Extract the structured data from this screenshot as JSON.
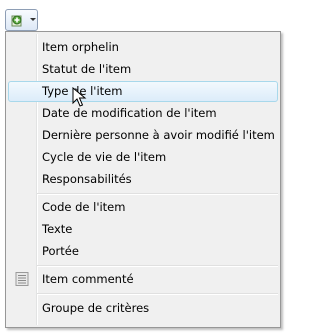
{
  "toolbar": {
    "button_icon": "add-column-icon"
  },
  "menu": {
    "items": [
      {
        "label": "Item orphelin"
      },
      {
        "label": "Statut de l'item"
      },
      {
        "label": "Type de l'item"
      },
      {
        "label": "Date de modification de l'item"
      },
      {
        "label": "Dernière personne à avoir modifié l'item"
      },
      {
        "label": "Cycle de vie de l'item"
      },
      {
        "label": "Responsabilités"
      },
      {
        "label": "Code de l'item"
      },
      {
        "label": "Texte"
      },
      {
        "label": "Portée"
      },
      {
        "label": "Item commenté",
        "icon": "comment-list-icon"
      },
      {
        "label": "Groupe de critères"
      }
    ],
    "hovered_item": "Type de l'item"
  }
}
